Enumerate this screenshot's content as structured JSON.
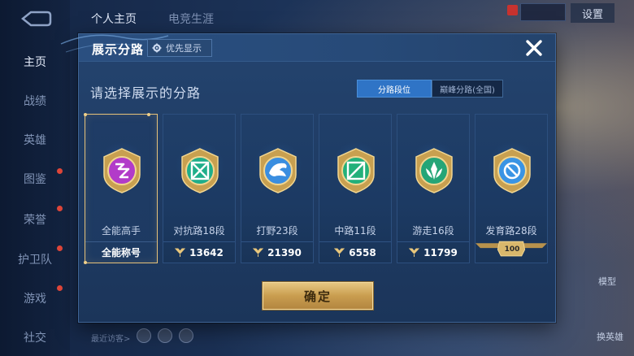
{
  "background": {
    "left_nav": [
      "主页",
      "战绩",
      "英雄",
      "图鉴",
      "荣誉",
      "护卫队",
      "游戏",
      "社交"
    ],
    "top_tabs": [
      "个人主页",
      "电竞生涯"
    ],
    "settings_label": "设置",
    "recent_visitors_label": "最近访客>",
    "model_label": "模型",
    "change_hero_label": "换英雄"
  },
  "modal": {
    "title": "展示分路",
    "priority_label": "优先显示",
    "subtitle": "请选择展示的分路",
    "toggle": {
      "options": [
        "分路段位",
        "巅峰分路(全国)"
      ],
      "selected": "分路段位"
    },
    "cards": [
      {
        "name": "全能高手",
        "footer": "全能称号",
        "emblem": "all-round-emblem-icon",
        "gem_color": "#b23bc9",
        "selected": true
      },
      {
        "name": "对抗路18段",
        "score": "13642",
        "emblem": "clash-lane-emblem-icon",
        "gem_color": "#1fae8a",
        "selected": false
      },
      {
        "name": "打野23段",
        "score": "21390",
        "emblem": "jungle-emblem-icon",
        "gem_color": "#3a8ee0",
        "selected": false
      },
      {
        "name": "中路11段",
        "score": "6558",
        "emblem": "mid-lane-emblem-icon",
        "gem_color": "#23b07a",
        "selected": false
      },
      {
        "name": "游走16段",
        "score": "11799",
        "emblem": "roam-emblem-icon",
        "gem_color": "#25a577",
        "selected": false
      },
      {
        "name": "发育路28段",
        "badge": "100",
        "emblem": "farm-lane-emblem-icon",
        "gem_color": "#3a94e4",
        "selected": false
      }
    ],
    "confirm_label": "确定",
    "close_icon": "close-icon"
  },
  "colors": {
    "accent_gold": "#e6c27a",
    "selected_toggle": "#2f74c6",
    "modal_bg": "#21416b"
  }
}
